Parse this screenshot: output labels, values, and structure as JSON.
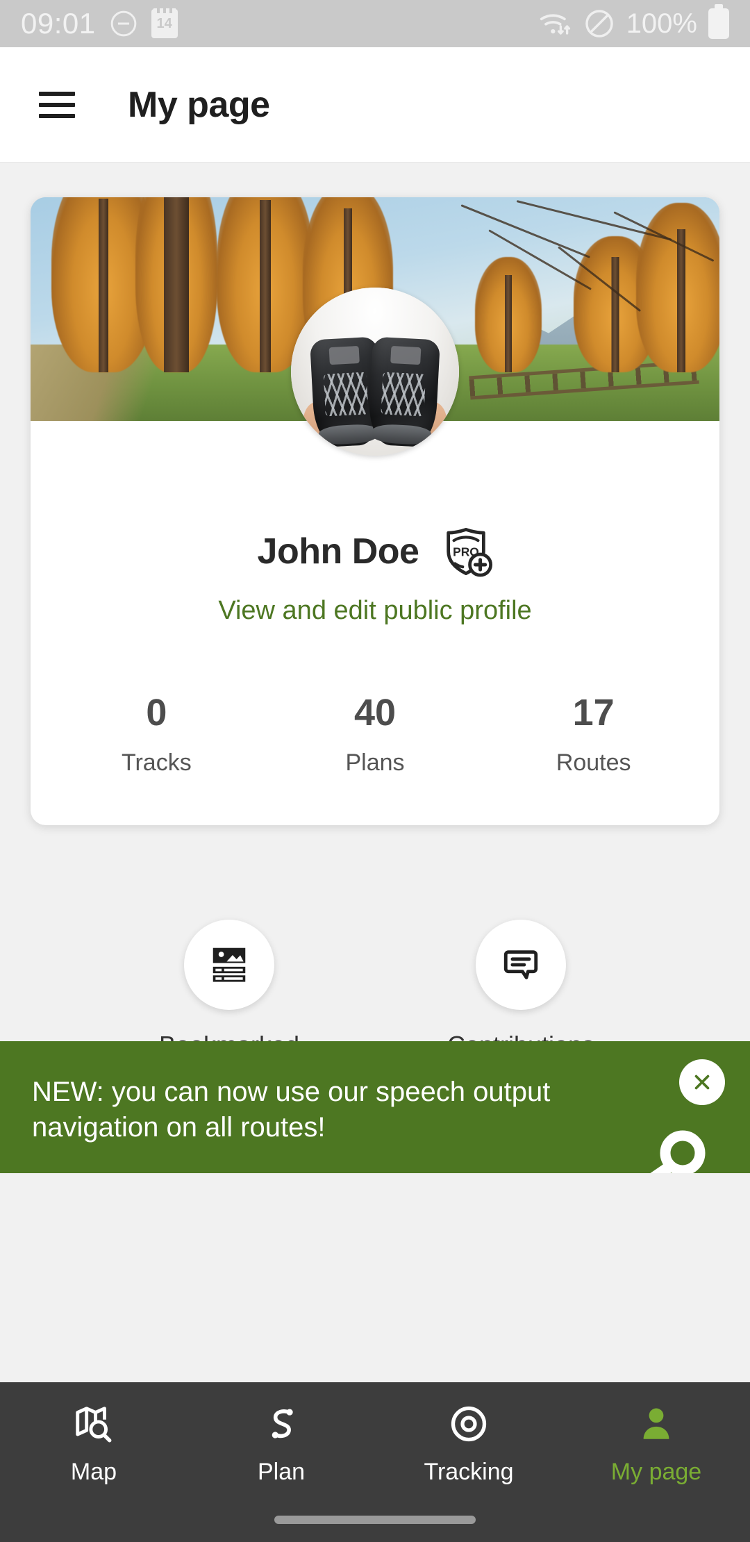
{
  "status_bar": {
    "time": "09:01",
    "dnd_icon": "minus-circle-icon",
    "calendar_icon": "calendar-icon",
    "calendar_day": "14",
    "wifi_icon": "wifi-transfer-icon",
    "block_icon": "no-sim-icon",
    "battery_text": "100%",
    "battery_icon": "battery-full-icon",
    "bg_color": "#c9c9c9"
  },
  "app_bar": {
    "menu_icon": "hamburger-menu-icon",
    "title": "My page"
  },
  "profile": {
    "cover_image_alt": "autumn larch forest with trail and mountain view",
    "avatar_image_alt": "person in white sweater holding black hiking boots",
    "name": "John Doe",
    "pro_badge_icon": "pro-plus-shield-icon",
    "pro_badge_text": "PRO",
    "profile_link": "View and edit public profile",
    "link_color": "#4d7722",
    "stats": [
      {
        "value": "0",
        "label": "Tracks"
      },
      {
        "value": "40",
        "label": "Plans"
      },
      {
        "value": "17",
        "label": "Routes"
      }
    ]
  },
  "actions": [
    {
      "label": "Bookmarked",
      "icon": "image-list-icon"
    },
    {
      "label": "Contributions",
      "icon": "speech-bubble-icon"
    }
  ],
  "promo_banner": {
    "message": "NEW: you can now use our speech output navigation on all routes!",
    "close_icon": "close-icon",
    "megaphone_icon": "megaphone-icon",
    "bg_color": "#4d7722"
  },
  "bottom_nav": {
    "active_color": "#7aad33",
    "bg_color": "#3d3d3d",
    "items": [
      {
        "label": "Map",
        "icon": "map-search-icon",
        "active": false
      },
      {
        "label": "Plan",
        "icon": "route-path-icon",
        "active": false
      },
      {
        "label": "Tracking",
        "icon": "target-circle-icon",
        "active": false
      },
      {
        "label": "My page",
        "icon": "person-icon",
        "active": true
      }
    ]
  }
}
